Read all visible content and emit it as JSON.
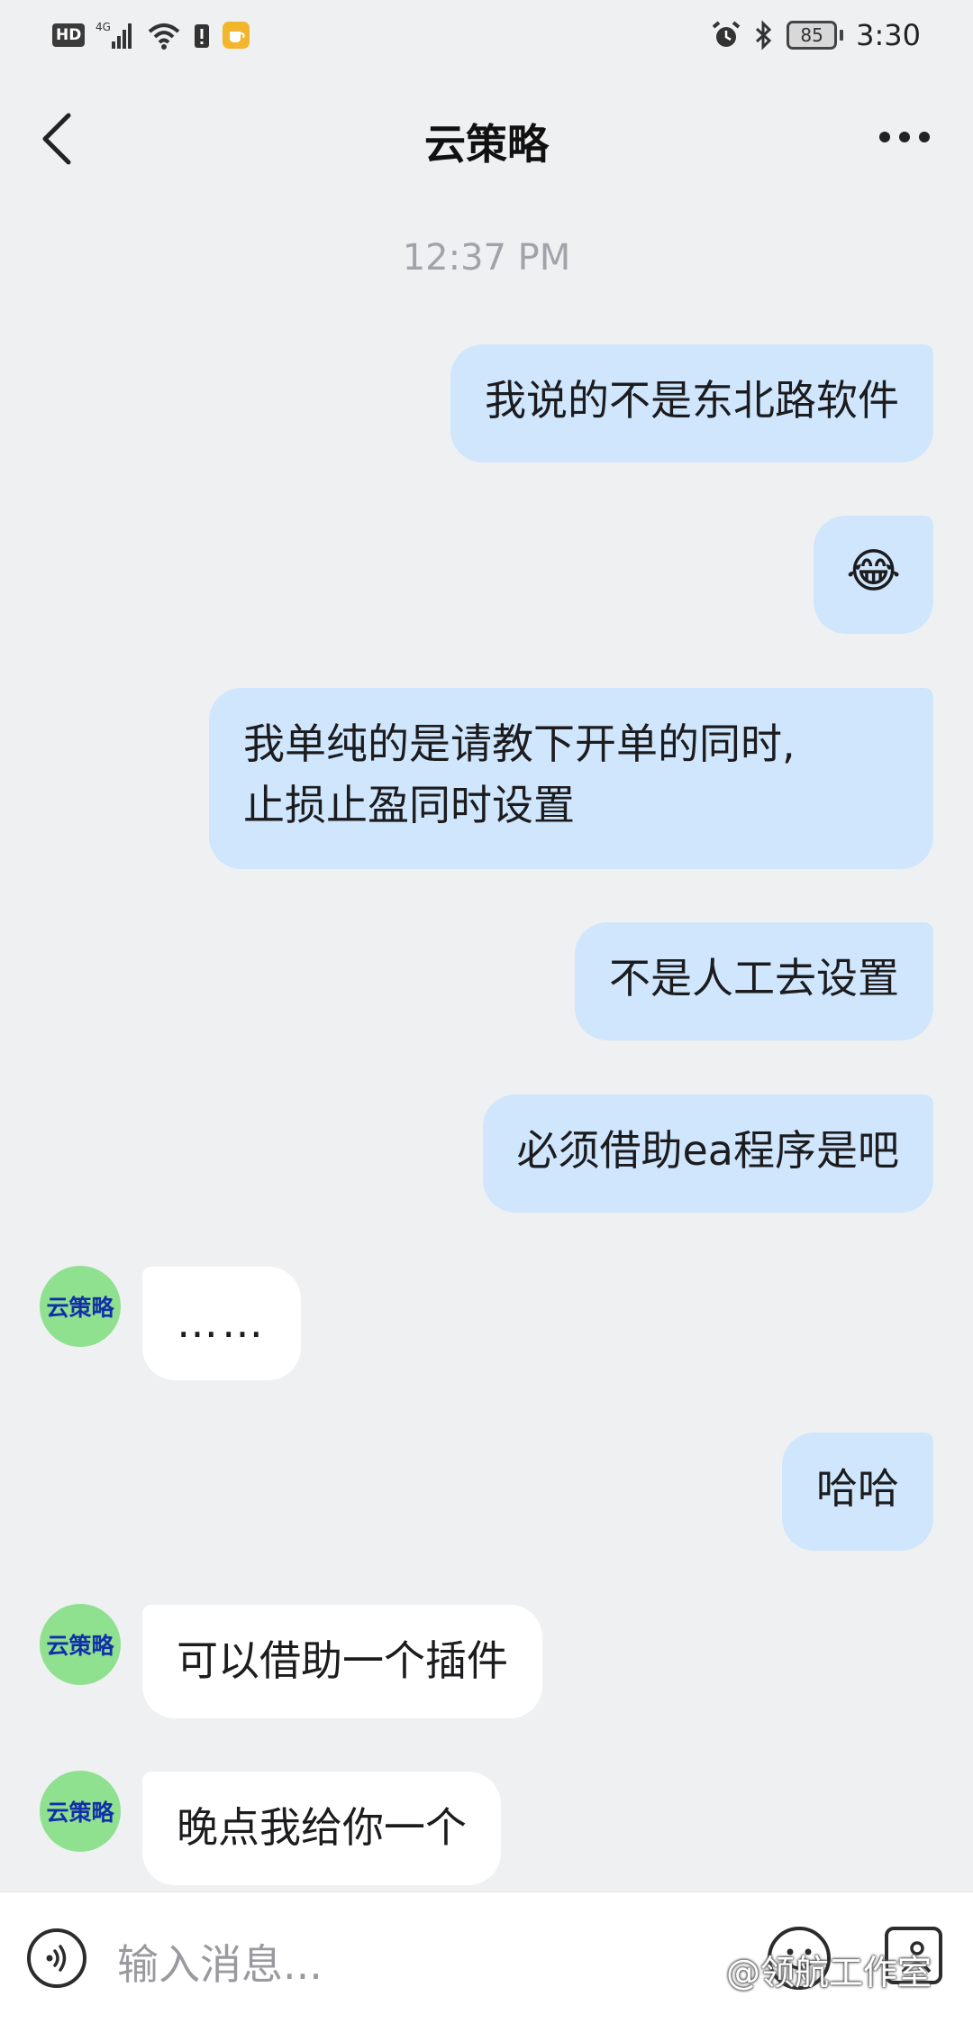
{
  "status_bar": {
    "hd": "HD",
    "network": "4G",
    "battery": "85",
    "time": "3:30"
  },
  "header": {
    "title": "云策略",
    "back_icon": "chevron-left-icon",
    "more_icon": "more-horizontal-icon"
  },
  "chat": {
    "timestamp": "12:37 PM",
    "avatar_text": "云策略",
    "messages": [
      {
        "from": "me",
        "text": "我说的不是东北路软件"
      },
      {
        "from": "me",
        "text": "😂"
      },
      {
        "from": "me",
        "line1": "我单纯的是请教下开单的同时,",
        "line2": "止损止盈同时设置"
      },
      {
        "from": "me",
        "text": "不是人工去设置"
      },
      {
        "from": "me",
        "text": "必须借助ea程序是吧"
      },
      {
        "from": "them",
        "text": "……"
      },
      {
        "from": "me",
        "text": "哈哈"
      },
      {
        "from": "them",
        "text": "可以借助一个插件"
      },
      {
        "from": "them",
        "text": "晚点我给你一个"
      }
    ]
  },
  "input_bar": {
    "placeholder": "输入消息...",
    "voice_icon": "voice-icon",
    "emoji_icon": "emoji-icon",
    "image_icon": "image-icon",
    "watermark": "@领航工作室"
  }
}
